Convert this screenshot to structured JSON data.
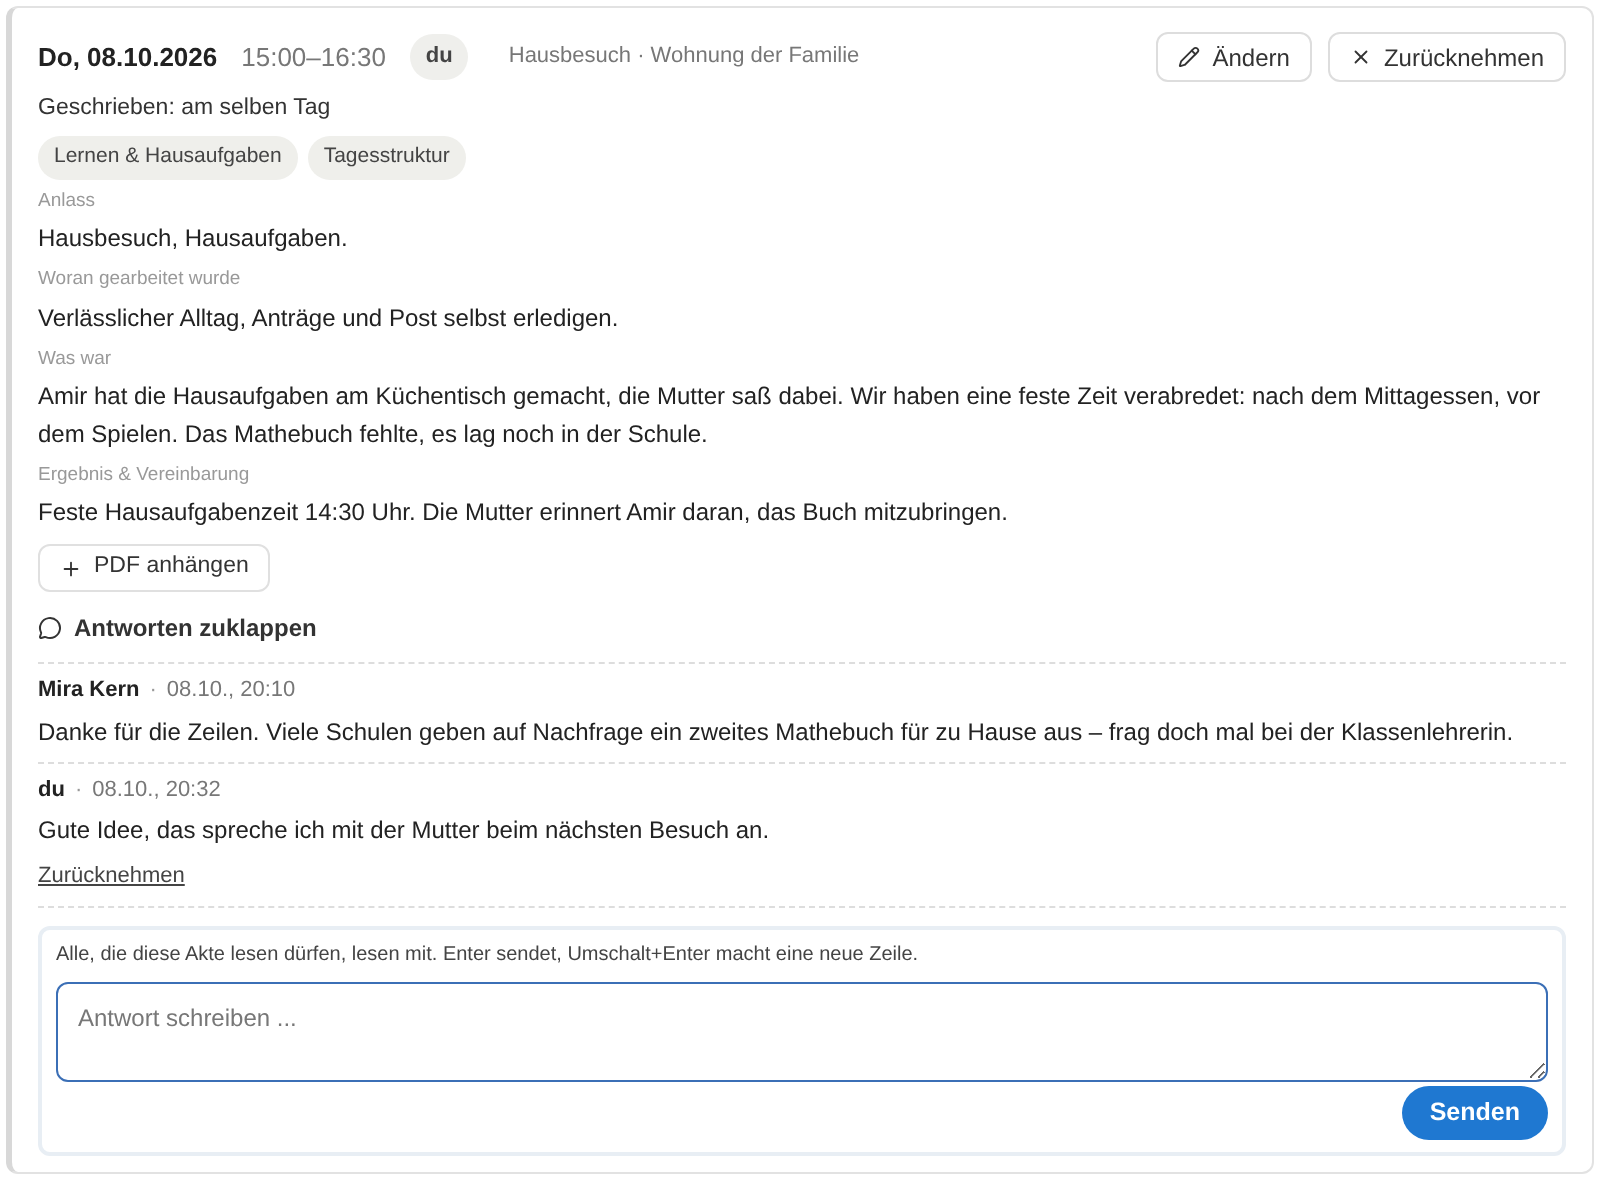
{
  "header": {
    "date": "Do, 08.10.2026",
    "time": "15:00–16:30",
    "author_badge": "du",
    "place": "Hausbesuch · Wohnung der Familie",
    "actions": [
      {
        "kind": "edit",
        "label": "Ändern"
      },
      {
        "kind": "revoke",
        "label": "Zurücknehmen"
      }
    ]
  },
  "written": "Geschrieben: am selben Tag",
  "tags": [
    "Lernen & Hausaufgaben",
    "Tagesstruktur"
  ],
  "sections": [
    {
      "label": "Anlass",
      "text": "Hausbesuch, Hausaufgaben."
    },
    {
      "label": "Woran gearbeitet wurde",
      "text": "Verlässlicher Alltag, Anträge und Post selbst erledigen."
    },
    {
      "label": "Was war",
      "text": "Amir hat die Hausaufgaben am Küchentisch gemacht, die Mutter saß dabei. Wir haben eine feste Zeit verabredet: nach dem Mittagessen, vor dem Spielen. Das Mathebuch fehlte, es lag noch in der Schule."
    },
    {
      "label": "Ergebnis & Vereinbarung",
      "text": "Feste Hausaufgabenzeit 14:30 Uhr. Die Mutter erinnert Amir daran, das Buch mitzubringen."
    }
  ],
  "attach_button": "PDF anhängen",
  "replies_toggle": "Antworten zuklappen",
  "reply_separator": "·",
  "replies": [
    {
      "author": "Mira Kern",
      "time": "08.10., 20:10",
      "text": "Danke für die Zeilen. Viele Schulen geben auf Nachfrage ein zweites Mathebuch für zu Hause aus – frag doch mal bei der Klassenlehrerin."
    },
    {
      "author": "du",
      "time": "08.10., 20:32",
      "text": "Gute Idee, das spreche ich mit der Mutter beim nächsten Besuch an.",
      "revoke_link": "Zurücknehmen"
    }
  ],
  "composer": {
    "hint": "Alle, die diese Akte lesen dürfen, lesen mit. Enter sendet, Umschalt+Enter macht eine neue Zeile.",
    "placeholder": "Antwort schreiben ...",
    "send": "Senden"
  }
}
